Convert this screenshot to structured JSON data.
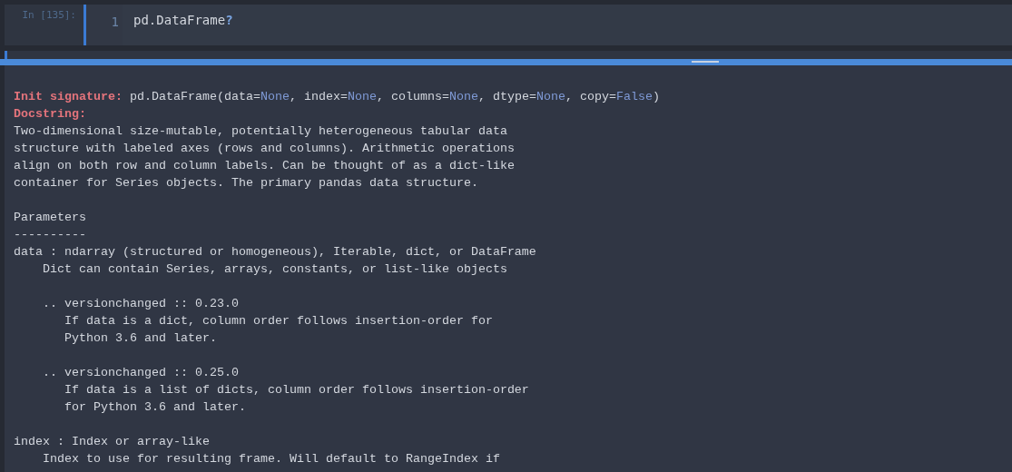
{
  "cell": {
    "prompt": "In [135]:",
    "line_number": "1",
    "code": [
      {
        "text": "pd.DataFrame",
        "kind": "plain"
      },
      {
        "text": "?",
        "kind": "operator"
      }
    ]
  },
  "pager": {
    "signature_label": "Init signature:",
    "signature": [
      {
        "text": "pd.DataFrame(data=",
        "kind": "plain"
      },
      {
        "text": "None",
        "kind": "keyword"
      },
      {
        "text": ", index=",
        "kind": "plain"
      },
      {
        "text": "None",
        "kind": "keyword"
      },
      {
        "text": ", columns=",
        "kind": "plain"
      },
      {
        "text": "None",
        "kind": "keyword"
      },
      {
        "text": ", dtype=",
        "kind": "plain"
      },
      {
        "text": "None",
        "kind": "keyword"
      },
      {
        "text": ", copy=",
        "kind": "plain"
      },
      {
        "text": "False",
        "kind": "keyword"
      },
      {
        "text": ")",
        "kind": "plain"
      }
    ],
    "docstring_label": "Docstring:",
    "paragraphs": [
      [
        "Two-dimensional size-mutable, potentially heterogeneous tabular data",
        "structure with labeled axes (rows and columns). Arithmetic operations",
        "align on both row and column labels. Can be thought of as a dict-like",
        "container for Series objects. The primary pandas data structure."
      ],
      [
        "Parameters",
        "----------",
        "data : ndarray (structured or homogeneous), Iterable, dict, or DataFrame",
        "    Dict can contain Series, arrays, constants, or list-like objects"
      ],
      [
        "    .. versionchanged :: 0.23.0",
        "       If data is a dict, column order follows insertion-order for",
        "       Python 3.6 and later."
      ],
      [
        "    .. versionchanged :: 0.25.0",
        "       If data is a list of dicts, column order follows insertion-order",
        "       for Python 3.6 and later."
      ],
      [
        "index : Index or array-like",
        "    Index to use for resulting frame. Will default to RangeIndex if"
      ]
    ]
  }
}
